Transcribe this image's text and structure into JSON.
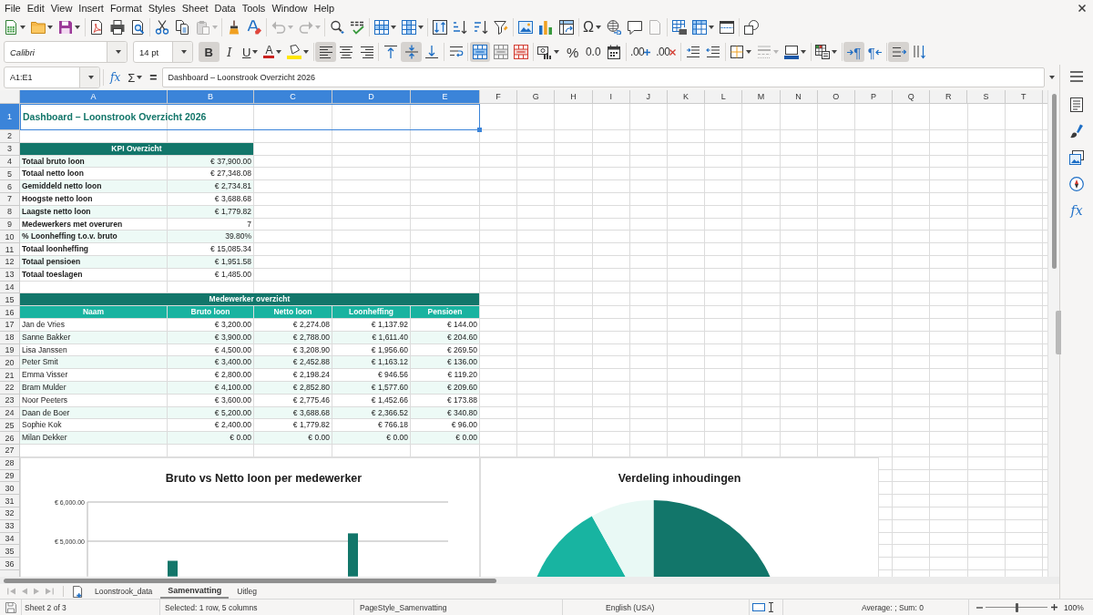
{
  "menu_bar": {
    "items": [
      "File",
      "Edit",
      "View",
      "Insert",
      "Format",
      "Styles",
      "Sheet",
      "Data",
      "Tools",
      "Window",
      "Help"
    ]
  },
  "standard_toolbar": {
    "paste": {
      "disabled": true
    },
    "undo": {
      "disabled": true
    },
    "redo": {
      "disabled": true
    },
    "special_character": {
      "label": "Ω"
    },
    "headers_and_footers": {
      "disabled": true
    }
  },
  "formatting_toolbar": {
    "font_name": "Calibri",
    "font_size": "14 pt",
    "bold": {
      "label": "B",
      "on": true
    },
    "italic": {
      "label": "I",
      "on": false
    },
    "underline": {
      "label": "U",
      "on": false
    },
    "font_color": {
      "label": "A"
    },
    "align_left": {
      "on": true
    },
    "align_center": {
      "on": false
    },
    "align_right": {
      "on": false
    },
    "align_top": {
      "on": false
    },
    "align_middle": {
      "on": true
    },
    "align_bottom": {
      "on": false
    },
    "wrap_text": {
      "on": false
    },
    "merge_and_center": {
      "on": true
    },
    "percent": {
      "label": "%"
    },
    "number": {
      "label": "0.0"
    },
    "add_decimal": {
      "label": ".00"
    },
    "delete_decimal": {
      "label": ".00"
    },
    "border_style": {
      "disabled": true
    },
    "left_to_right": {
      "label": "¶",
      "on": true
    },
    "right_to_left": {
      "label": "¶",
      "on": false
    },
    "text_left_to_right": {
      "on": true
    },
    "text_top_to_bottom": {
      "on": false
    }
  },
  "formula_bar": {
    "name_box": "A1:E1",
    "function_wizard": "fx",
    "sum": "Σ",
    "equals": "=",
    "content": "Dashboard – Loonstrook Overzicht 2026"
  },
  "sheet": {
    "columns": [
      {
        "label": "A",
        "selected": true
      },
      {
        "label": "B",
        "selected": true
      },
      {
        "label": "C",
        "selected": true
      },
      {
        "label": "D",
        "selected": true
      },
      {
        "label": "E",
        "selected": true
      },
      {
        "label": "F",
        "selected": false
      },
      {
        "label": "G",
        "selected": false
      },
      {
        "label": "H",
        "selected": false
      },
      {
        "label": "I",
        "selected": false
      },
      {
        "label": "J",
        "selected": false
      },
      {
        "label": "K",
        "selected": false
      },
      {
        "label": "L",
        "selected": false
      },
      {
        "label": "M",
        "selected": false
      },
      {
        "label": "N",
        "selected": false
      },
      {
        "label": "O",
        "selected": false
      },
      {
        "label": "P",
        "selected": false
      },
      {
        "label": "Q",
        "selected": false
      },
      {
        "label": "R",
        "selected": false
      },
      {
        "label": "S",
        "selected": false
      },
      {
        "label": "T",
        "selected": false
      }
    ],
    "rows": [
      {
        "label": "1",
        "selected": true
      },
      {
        "label": "2",
        "selected": false
      },
      {
        "label": "3",
        "selected": false
      },
      {
        "label": "4",
        "selected": false
      },
      {
        "label": "5",
        "selected": false
      },
      {
        "label": "6",
        "selected": false
      },
      {
        "label": "7",
        "selected": false
      },
      {
        "label": "8",
        "selected": false
      },
      {
        "label": "9",
        "selected": false
      },
      {
        "label": "10",
        "selected": false
      },
      {
        "label": "11",
        "selected": false
      },
      {
        "label": "12",
        "selected": false
      },
      {
        "label": "13",
        "selected": false
      },
      {
        "label": "14",
        "selected": false
      },
      {
        "label": "15",
        "selected": false
      },
      {
        "label": "16",
        "selected": false
      },
      {
        "label": "17",
        "selected": false
      },
      {
        "label": "18",
        "selected": false
      },
      {
        "label": "19",
        "selected": false
      },
      {
        "label": "20",
        "selected": false
      },
      {
        "label": "21",
        "selected": false
      },
      {
        "label": "22",
        "selected": false
      },
      {
        "label": "23",
        "selected": false
      },
      {
        "label": "24",
        "selected": false
      },
      {
        "label": "25",
        "selected": false
      },
      {
        "label": "26",
        "selected": false
      },
      {
        "label": "27",
        "selected": false
      },
      {
        "label": "28",
        "selected": false
      },
      {
        "label": "29",
        "selected": false
      },
      {
        "label": "30",
        "selected": false
      },
      {
        "label": "31",
        "selected": false
      },
      {
        "label": "32",
        "selected": false
      },
      {
        "label": "33",
        "selected": false
      },
      {
        "label": "34",
        "selected": false
      },
      {
        "label": "35",
        "selected": false
      },
      {
        "label": "36",
        "selected": false
      }
    ],
    "title": {
      "text": "Dashboard – Loonstrook Overzicht 2026",
      "selected": true
    },
    "kpi_table": {
      "heading": "KPI Overzicht",
      "rows": [
        {
          "label": "Totaal bruto loon",
          "value": "€ 37,900.00"
        },
        {
          "label": "Totaal netto loon",
          "value": "€ 27,348.08"
        },
        {
          "label": "Gemiddeld netto loon",
          "value": "€ 2,734.81"
        },
        {
          "label": "Hoogste netto loon",
          "value": "€ 3,688.68"
        },
        {
          "label": "Laagste netto loon",
          "value": "€ 1,779.82"
        },
        {
          "label": "Medewerkers met overuren",
          "value": "7"
        },
        {
          "label": "% Loonheffing t.o.v. bruto",
          "value": "39.80%"
        },
        {
          "label": "Totaal loonheffing",
          "value": "€ 15,085.34"
        },
        {
          "label": "Totaal pensioen",
          "value": "€ 1,951.58"
        },
        {
          "label": "Totaal toeslagen",
          "value": "€ 1,485.00"
        }
      ]
    },
    "employee_table": {
      "heading": "Medewerker overzicht",
      "columns": [
        "Naam",
        "Bruto loon",
        "Netto loon",
        "Loonheffing",
        "Pensioen"
      ],
      "rows": [
        [
          "Jan de Vries",
          "€ 3,200.00",
          "€ 2,274.08",
          "€ 1,137.92",
          "€ 144.00"
        ],
        [
          "Sanne Bakker",
          "€ 3,900.00",
          "€ 2,788.00",
          "€ 1,611.40",
          "€ 204.60"
        ],
        [
          "Lisa Janssen",
          "€ 4,500.00",
          "€ 3,208.90",
          "€ 1,956.60",
          "€ 269.50"
        ],
        [
          "Peter Smit",
          "€ 3,400.00",
          "€ 2,452.88",
          "€ 1,163.12",
          "€ 136.00"
        ],
        [
          "Emma Visser",
          "€ 2,800.00",
          "€ 2,198.24",
          "€ 946.56",
          "€ 119.20"
        ],
        [
          "Bram Mulder",
          "€ 4,100.00",
          "€ 2,852.80",
          "€ 1,577.60",
          "€ 209.60"
        ],
        [
          "Noor Peeters",
          "€ 3,600.00",
          "€ 2,775.46",
          "€ 1,452.66",
          "€ 173.88"
        ],
        [
          "Daan de Boer",
          "€ 5,200.00",
          "€ 3,688.68",
          "€ 2,366.52",
          "€ 340.80"
        ],
        [
          "Sophie Kok",
          "€ 2,400.00",
          "€ 1,779.82",
          "€ 766.18",
          "€ 96.00"
        ],
        [
          "Milan Dekker",
          "€ 0.00",
          "€ 0.00",
          "€ 0.00",
          "€ 0.00"
        ]
      ]
    },
    "charts": [
      {
        "chart_data": {
          "type": "bar",
          "title": "Bruto vs Netto loon per medewerker",
          "ylim": [
            4100,
            6000
          ],
          "yticks": [
            {
              "value": 5000,
              "label": "€ 5,000.00"
            },
            {
              "value": 6000,
              "label": "€ 6,000.00"
            }
          ],
          "series": [
            {
              "color": "#12766a",
              "values": [
                null,
                null,
                4500,
                null,
                null,
                null,
                null,
                5200,
                null,
                null
              ]
            }
          ]
        }
      },
      {
        "title": "Verdeling inhoudingen"
      }
    ]
  },
  "sheet_tabs": {
    "navigation_disabled": true,
    "tabs": [
      {
        "label": "Loonstrook_data",
        "selected": false
      },
      {
        "label": "Samenvatting",
        "selected": true
      },
      {
        "label": "Uitleg",
        "selected": false
      }
    ]
  },
  "sidebar": {
    "functions_button": "fx"
  },
  "status_bar": {
    "sheet_position": "Sheet 2 of 3",
    "selection": "Selected: 1 row, 5 columns",
    "page_style": "PageStyle_Samenvatting",
    "language": "English (USA)",
    "summary": "Average: ; Sum: 0",
    "zoom": {
      "level": 0.5,
      "reading": "100%"
    }
  }
}
